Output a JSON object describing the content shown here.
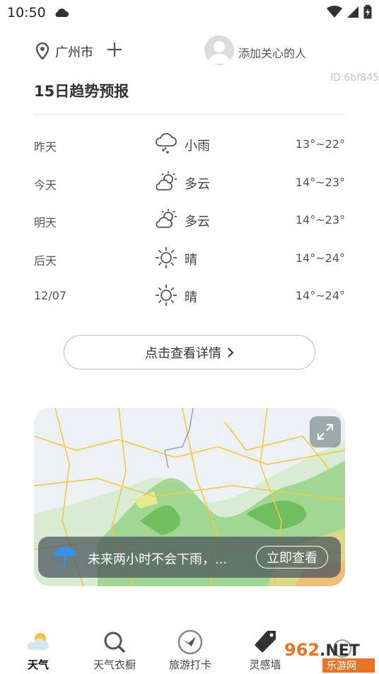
{
  "status": {
    "time": "10:50"
  },
  "header": {
    "city": "广州市",
    "care_label": "添加关心的人"
  },
  "watermark_id": "ID:6bf845",
  "forecast": {
    "title": "15日趋势预报",
    "rows": [
      {
        "day": "昨天",
        "icon": "rain-icon",
        "condition": "小雨",
        "temp": "13°~22°"
      },
      {
        "day": "今天",
        "icon": "partly-cloudy-icon",
        "condition": "多云",
        "temp": "14°~23°"
      },
      {
        "day": "明天",
        "icon": "partly-cloudy-icon",
        "condition": "多云",
        "temp": "14°~23°"
      },
      {
        "day": "后天",
        "icon": "sun-icon",
        "condition": "晴",
        "temp": "14°~24°"
      },
      {
        "day": "12/07",
        "icon": "sun-icon",
        "condition": "晴",
        "temp": "14°~24°"
      }
    ],
    "detail_button": "点击查看详情"
  },
  "radar": {
    "message": "未来两小时不会下雨，...",
    "view_button": "立即查看"
  },
  "tabs": [
    {
      "label": "天气",
      "icon": "weather-icon",
      "active": true
    },
    {
      "label": "天气衣橱",
      "icon": "wardrobe-search-icon",
      "active": false
    },
    {
      "label": "旅游打卡",
      "icon": "travel-bird-icon",
      "active": false
    },
    {
      "label": "灵感墙",
      "icon": "tag-icon",
      "active": false
    }
  ],
  "site_watermark": {
    "logo": "962.NET",
    "sub": "乐游网"
  },
  "colors": {
    "accent_blue": "#3a8ee6",
    "map_green": "#7cc46a",
    "text_dark": "#333333"
  }
}
